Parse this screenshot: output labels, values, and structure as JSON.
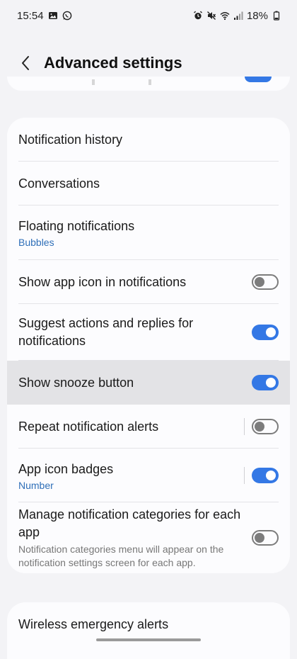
{
  "status_bar": {
    "time": "15:54",
    "battery": "18%",
    "left_icons": [
      "gallery-icon",
      "whatsapp-icon"
    ],
    "right_icons": [
      "alarm-icon",
      "mute-icon",
      "wifi-icon",
      "signal-icon",
      "battery-icon"
    ]
  },
  "header": {
    "title": "Advanced settings"
  },
  "items": [
    {
      "title": "Notification history"
    },
    {
      "title": "Conversations"
    },
    {
      "title": "Floating notifications",
      "subtitle": "Bubbles"
    },
    {
      "title": "Show app icon in notifications",
      "toggle": "off"
    },
    {
      "title": "Suggest actions and replies for notifications",
      "toggle": "on"
    },
    {
      "title": "Show snooze button",
      "toggle": "on"
    },
    {
      "title": "Repeat notification alerts",
      "toggle": "off"
    },
    {
      "title": "App icon badges",
      "subtitle": "Number",
      "toggle": "on"
    },
    {
      "title": "Manage notification categories for each app",
      "description": "Notification categories menu will appear on the notification settings screen for each app.",
      "toggle": "off"
    }
  ],
  "bottom_items": [
    {
      "title": "Wireless emergency alerts"
    }
  ],
  "colors": {
    "accent": "#3478e5",
    "subtitle": "#2f6fb8",
    "background": "#f3f3f6",
    "card": "#fcfcfe",
    "highlight": "#e3e3e6"
  }
}
